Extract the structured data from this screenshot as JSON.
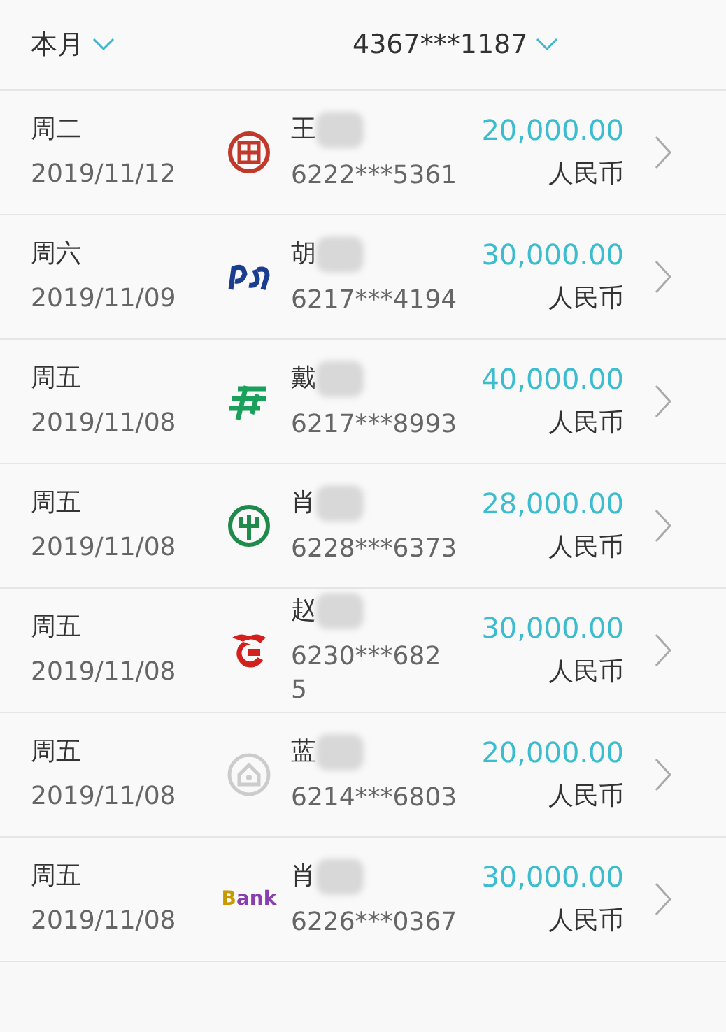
{
  "filters": {
    "period": "本月",
    "card": "4367***1187"
  },
  "transactions": [
    {
      "weekday": "周二",
      "date": "2019/11/12",
      "kind": "icbc",
      "name": "王",
      "card": "6222***5361",
      "wrap": false,
      "amount": "20,000.00",
      "currency": "人民币"
    },
    {
      "weekday": "周六",
      "date": "2019/11/09",
      "kind": "spdb",
      "name": "胡",
      "card": "6217***4194",
      "wrap": false,
      "amount": "30,000.00",
      "currency": "人民币"
    },
    {
      "weekday": "周五",
      "date": "2019/11/08",
      "kind": "psbc",
      "name": "戴",
      "card": "6217***8993",
      "wrap": false,
      "amount": "40,000.00",
      "currency": "人民币"
    },
    {
      "weekday": "周五",
      "date": "2019/11/08",
      "kind": "abc",
      "name": "肖",
      "card": "6228***6373",
      "wrap": false,
      "amount": "28,000.00",
      "currency": "人民币"
    },
    {
      "weekday": "周五",
      "date": "2019/11/08",
      "kind": "hxb",
      "name": "赵",
      "card": "6230***6825",
      "wrap": true,
      "amount": "30,000.00",
      "currency": "人民币"
    },
    {
      "weekday": "周五",
      "date": "2019/11/08",
      "kind": "house",
      "name": "蓝",
      "card": "6214***6803",
      "wrap": false,
      "amount": "20,000.00",
      "currency": "人民币"
    },
    {
      "weekday": "周五",
      "date": "2019/11/08",
      "kind": "text",
      "logo_text": "Bank",
      "name": "肖",
      "card": "6226***0367",
      "wrap": false,
      "amount": "30,000.00",
      "currency": "人民币"
    }
  ]
}
